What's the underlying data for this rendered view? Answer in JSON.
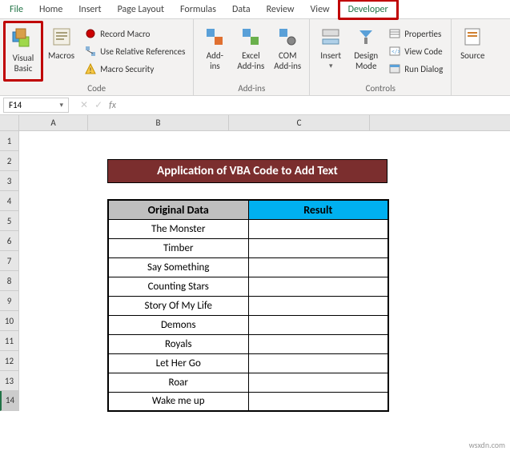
{
  "tabs": {
    "file": "File",
    "home": "Home",
    "insert": "Insert",
    "page_layout": "Page Layout",
    "formulas": "Formulas",
    "data": "Data",
    "review": "Review",
    "view": "View",
    "developer": "Developer"
  },
  "ribbon": {
    "code": {
      "visual_basic": "Visual\nBasic",
      "macros": "Macros",
      "record_macro": "Record Macro",
      "use_relative": "Use Relative References",
      "macro_security": "Macro Security",
      "label": "Code"
    },
    "addins": {
      "addins": "Add-\nins",
      "excel_addins": "Excel\nAdd-ins",
      "com_addins": "COM\nAdd-ins",
      "label": "Add-ins"
    },
    "controls": {
      "insert": "Insert",
      "design_mode": "Design\nMode",
      "properties": "Properties",
      "view_code": "View Code",
      "run_dialog": "Run Dialog",
      "label": "Controls"
    },
    "xml": {
      "source": "Source"
    }
  },
  "namebox": {
    "value": "F14"
  },
  "formula": {
    "value": ""
  },
  "columns": [
    "A",
    "B",
    "C"
  ],
  "rows": [
    "1",
    "2",
    "3",
    "4",
    "5",
    "6",
    "7",
    "8",
    "9",
    "10",
    "11",
    "12",
    "13",
    "14"
  ],
  "active_row": "14",
  "title": "Application of VBA Code to Add Text",
  "headers": {
    "original": "Original Data",
    "result": "Result"
  },
  "data_rows": [
    "The Monster",
    "Timber",
    "Say Something",
    "Counting Stars",
    "Story Of My Life",
    "Demons",
    "Royals",
    "Let Her Go",
    "Roar",
    "Wake me up"
  ],
  "watermark": "wsxdn.com",
  "chart_data": {
    "type": "table",
    "title": "Application of VBA Code to Add Text",
    "columns": [
      "Original Data",
      "Result"
    ],
    "rows": [
      [
        "The Monster",
        ""
      ],
      [
        "Timber",
        ""
      ],
      [
        "Say Something",
        ""
      ],
      [
        "Counting Stars",
        ""
      ],
      [
        "Story Of My Life",
        ""
      ],
      [
        "Demons",
        ""
      ],
      [
        "Royals",
        ""
      ],
      [
        "Let Her Go",
        ""
      ],
      [
        "Roar",
        ""
      ],
      [
        "Wake me up",
        ""
      ]
    ]
  }
}
